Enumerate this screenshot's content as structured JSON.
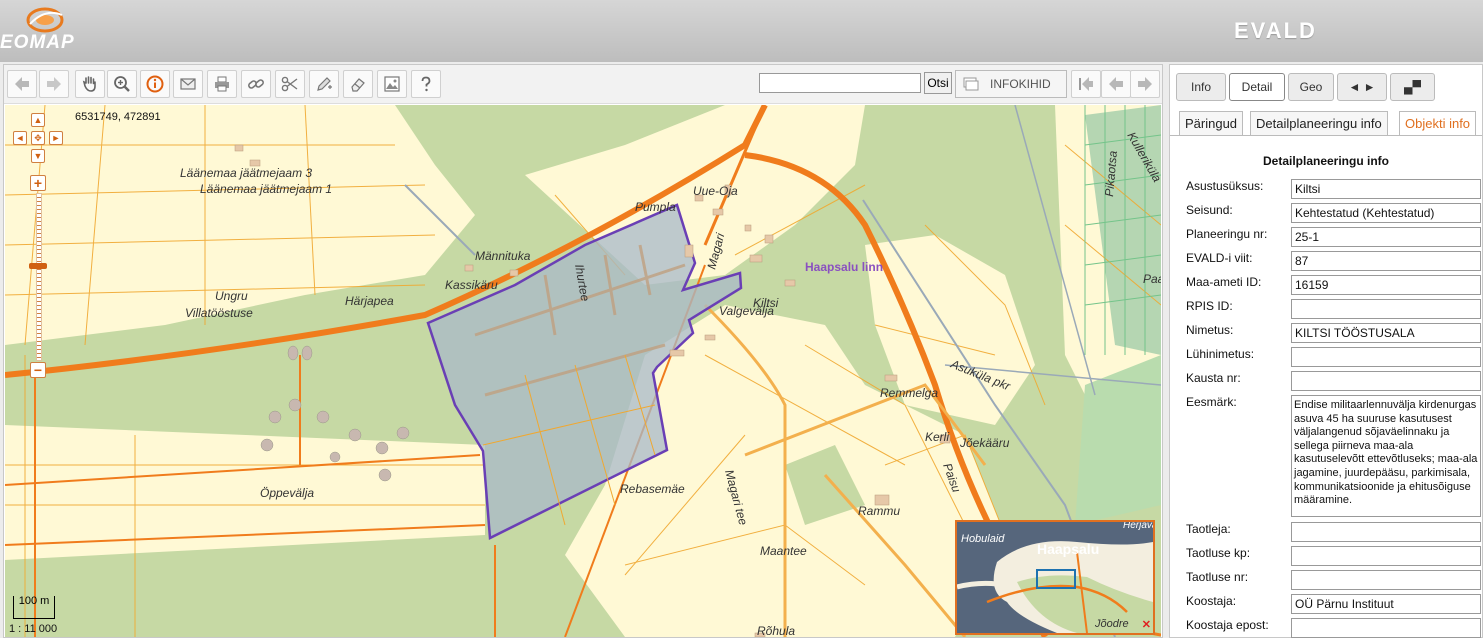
{
  "header": {
    "logo_text": "EOMAP",
    "app_name": "EVALD"
  },
  "toolbar": {
    "buttons": [
      {
        "name": "back-button",
        "icon": "arrow-left-icon"
      },
      {
        "name": "forward-button",
        "icon": "arrow-right-icon"
      },
      {
        "name": "pan-button",
        "icon": "hand-icon"
      },
      {
        "name": "zoom-button",
        "icon": "magnifier-icon"
      },
      {
        "name": "info-button",
        "icon": "info-icon"
      },
      {
        "name": "email-button",
        "icon": "envelope-icon"
      },
      {
        "name": "print-button",
        "icon": "printer-icon"
      },
      {
        "name": "link-button",
        "icon": "chain-link-icon"
      },
      {
        "name": "measure-button",
        "icon": "scissors-icon"
      },
      {
        "name": "draw-button",
        "icon": "pencil-icon"
      },
      {
        "name": "erase-button",
        "icon": "eraser-icon"
      },
      {
        "name": "image-button",
        "icon": "image-icon"
      },
      {
        "name": "help-button",
        "icon": "question-icon"
      }
    ],
    "search_value": "",
    "search_button_label": "Otsi",
    "infokihid_label": "INFOKIHID"
  },
  "map": {
    "coordinates": "6531749, 472891",
    "scale_bar_label": "100 m",
    "scale_ratio": "1 : 11 000",
    "labels": {
      "l1": "Läänemaa jäätmejaam 3",
      "l2": "Läänemaa jäätmejaam 1",
      "l3": "Männituka",
      "l4": "Härjapea",
      "l5": "Kassikäru",
      "l6": "Ungru",
      "l7": "Villatööstuse",
      "l8": "Pumpla",
      "l9": "Uue-Oja",
      "l10": "Magari",
      "l11": "Haapsalu linn",
      "l12": "Kiltsi",
      "l13": "Valgevälja",
      "l14": "Ihurtee",
      "l15": "Asuküla pkr",
      "l16": "Remmelga",
      "l17": "Kerli",
      "l18": "Jõekääru",
      "l19": "Paisu",
      "l20": "Öppevälja",
      "l21": "Rebasemäe",
      "l22": "Magari tee",
      "l23": "Rammu",
      "l24": "Maantee",
      "l25": "Rõhula",
      "l26": "Pikaotsa",
      "l27": "Kulleriküla",
      "l28": "Paar"
    },
    "overview": {
      "l1": "Hobulaid",
      "l2": "Haapsalu",
      "l3": "Herjava",
      "l4": "Jõodre"
    }
  },
  "side_panel": {
    "tabs": [
      "Info",
      "Detail",
      "Geo",
      "◄ ►",
      "▄▀"
    ],
    "active_tab": 1,
    "subtabs": [
      "Päringud",
      "Detailplaneeringu info",
      "Objekti info"
    ],
    "active_subtab": 2,
    "form_title": "Detailplaneeringu info",
    "fields": [
      {
        "label": "Asustusüksus:",
        "value": "Kiltsi"
      },
      {
        "label": "Seisund:",
        "value": "Kehtestatud (Kehtestatud)"
      },
      {
        "label": "Planeeringu nr:",
        "value": "25-1"
      },
      {
        "label": "EVALD-i viit:",
        "value": "87"
      },
      {
        "label": "Maa-ameti ID:",
        "value": "16159"
      },
      {
        "label": "RPIS ID:",
        "value": ""
      },
      {
        "label": "Nimetus:",
        "value": "KILTSI TÖÖSTUSALA"
      },
      {
        "label": "Lühinimetus:",
        "value": ""
      },
      {
        "label": "Kausta nr:",
        "value": ""
      },
      {
        "label": "Eesmärk:",
        "value": "Endise militaarlennuvälja kirdenurgas asuva 45 ha suuruse kasutusest väljalangenud sõjaväelinnaku ja sellega piirneva maa-ala kasutuselevõtt ettevõtluseks; maa-ala jagamine, juurdepääsu, parkimisala, kommunikatsioonide ja ehitusõiguse määramine."
      },
      {
        "label": "Taotleja:",
        "value": ""
      },
      {
        "label": "Taotluse kp:",
        "value": ""
      },
      {
        "label": "Taotluse nr:",
        "value": ""
      },
      {
        "label": "Koostaja:",
        "value": "OÜ Pärnu Instituut"
      },
      {
        "label": "Koostaja epost:",
        "value": ""
      }
    ]
  },
  "colors": {
    "accent": "#e07020",
    "forest": "#c6d9a4",
    "field": "#fff9d5",
    "plan_fill": "#a8b8c8",
    "plan_border": "#6a3fb5",
    "road": "#f07c1c"
  }
}
